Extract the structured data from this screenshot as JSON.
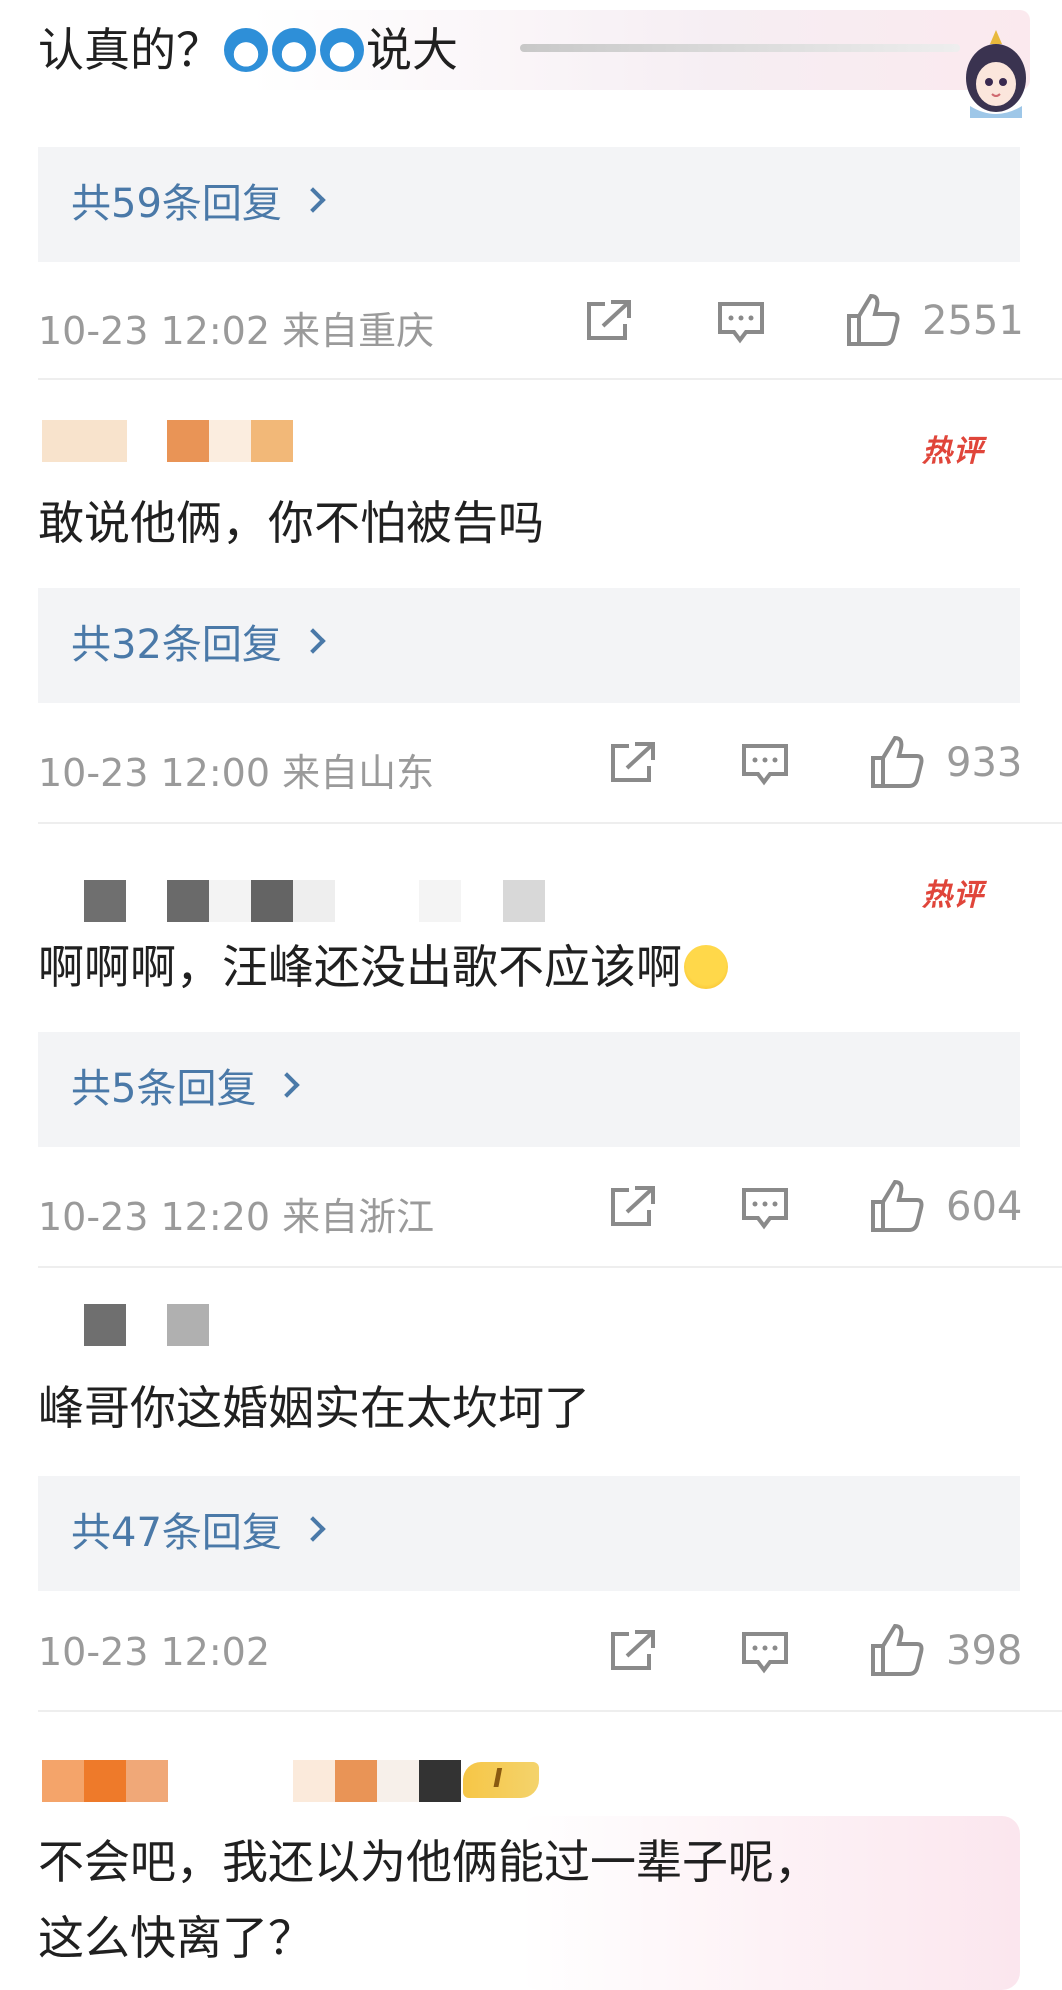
{
  "comments": [
    {
      "text_main": "认真的？",
      "text_tail": "说大",
      "replies": "共59条回复",
      "meta": "10-23 12:02  来自重庆",
      "likes": "2551",
      "hot_badge": ""
    },
    {
      "text_main": "敢说他俩，你不怕被告吗",
      "replies": "共32条回复",
      "meta": "10-23 12:00  来自山东",
      "likes": "933",
      "hot_badge": "热评"
    },
    {
      "text_main": "啊啊啊，汪峰还没出歌不应该啊",
      "replies": "共5条回复",
      "meta": "10-23 12:20  来自浙江",
      "likes": "604",
      "hot_badge": "热评"
    },
    {
      "text_main": "峰哥你这婚姻实在太坎坷了",
      "replies": "共47条回复",
      "meta": "10-23 12:02",
      "likes": "398"
    },
    {
      "text_line1": "不会吧，我还以为他俩能过一辈子呢，",
      "text_line2": "这么快离了？",
      "level_badge": "I"
    }
  ],
  "icons": {
    "share": "share-icon",
    "comment": "comment-icon",
    "like": "like-icon"
  },
  "colors": {
    "link": "#4a79a8",
    "meta": "#9a9a9a",
    "hot": "#e0453a",
    "reply_bg": "#f3f4f6"
  }
}
